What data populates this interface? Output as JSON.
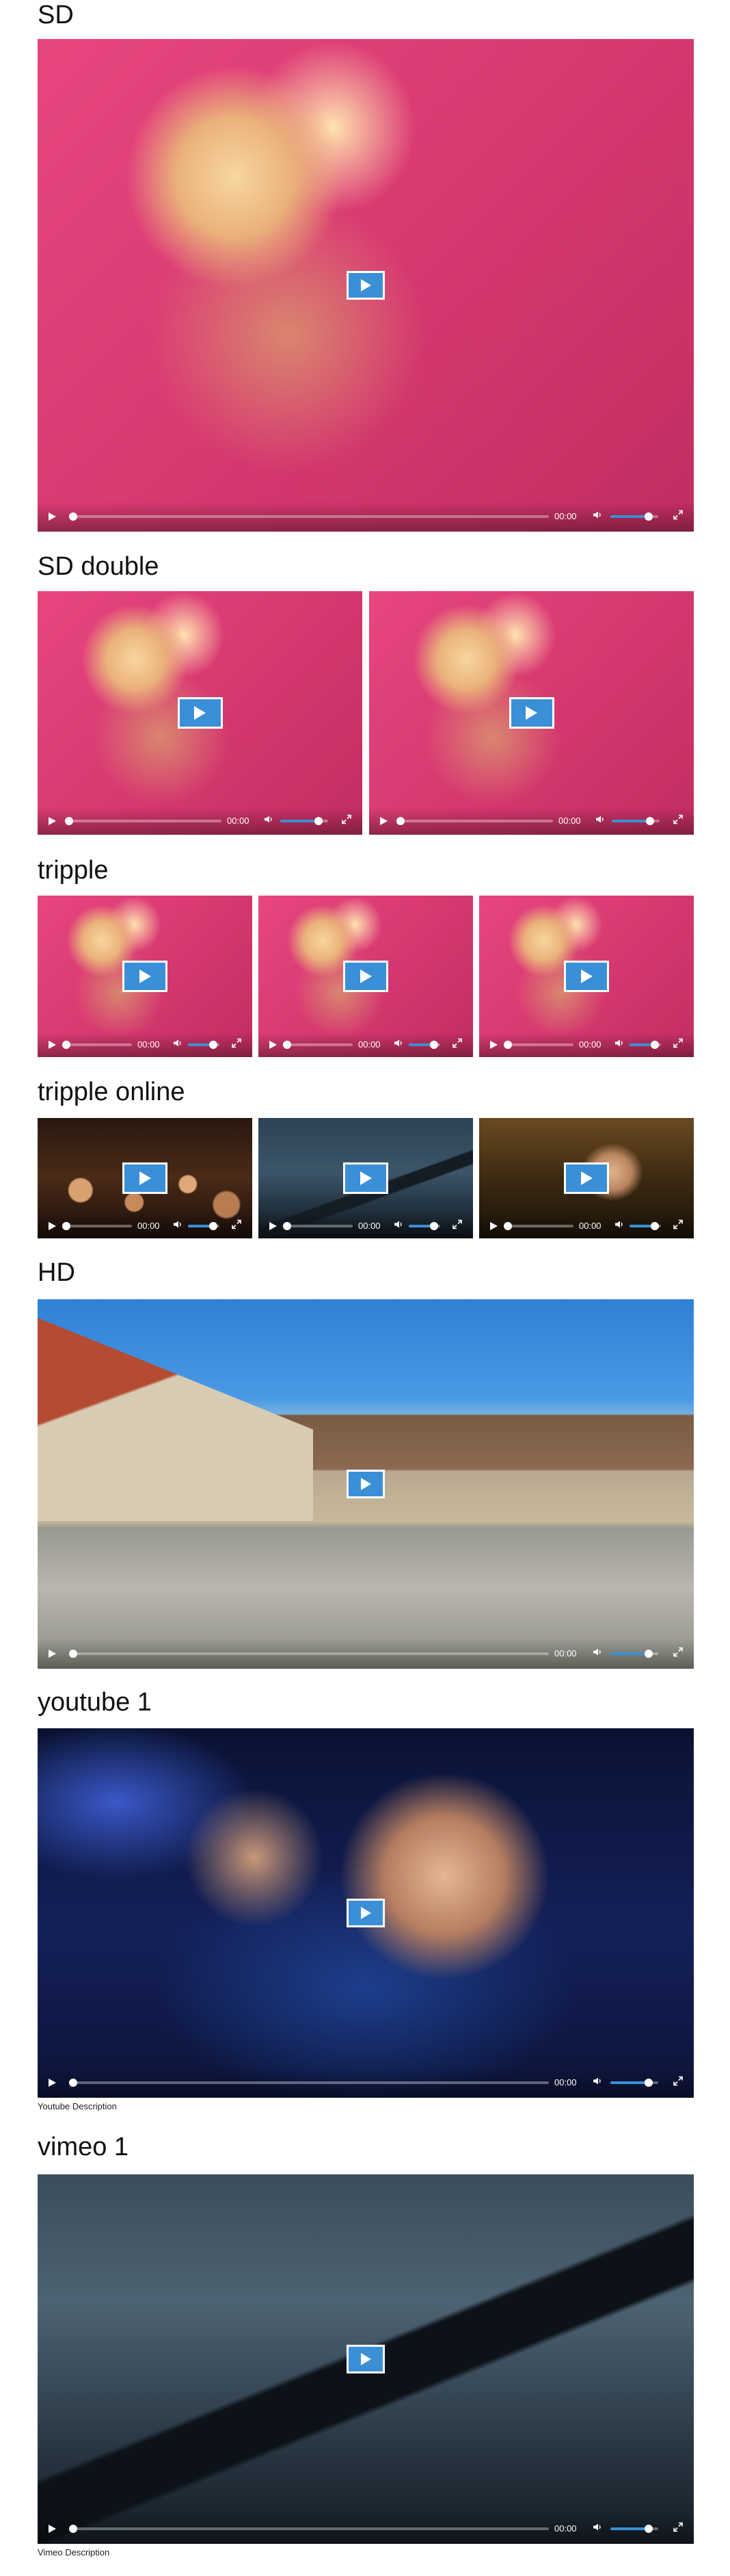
{
  "colors": {
    "accent": "#3a8fd6",
    "page_bg": "#ffffff"
  },
  "sections": {
    "sd": {
      "title": "SD"
    },
    "sd_double": {
      "title": "SD double"
    },
    "tripple": {
      "title": "tripple"
    },
    "tripple_online": {
      "title": "tripple online"
    },
    "hd": {
      "title": "HD"
    },
    "youtube1": {
      "title": "youtube 1",
      "description": "Youtube Description"
    },
    "vimeo1": {
      "title": "vimeo 1",
      "description": "Vimeo Description"
    }
  },
  "player": {
    "time": "00:00",
    "progress": 0.0,
    "volume": 0.8,
    "icons": [
      "play-icon",
      "volume-icon",
      "fullscreen-icon"
    ]
  }
}
